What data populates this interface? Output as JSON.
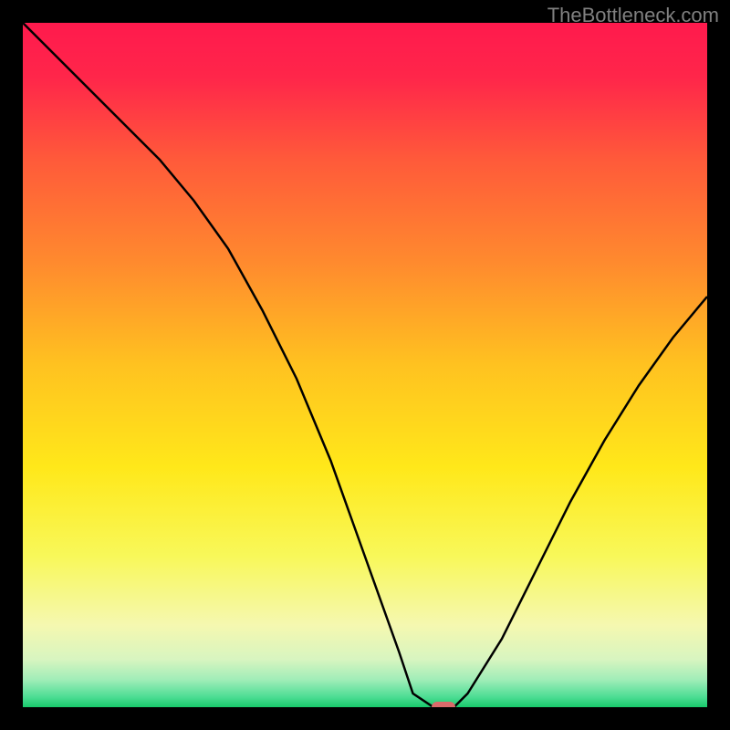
{
  "watermark": "TheBottleneck.com",
  "chart_data": {
    "type": "line",
    "title": "",
    "xlabel": "",
    "ylabel": "",
    "xlim": [
      0,
      100
    ],
    "ylim": [
      0,
      100
    ],
    "series": [
      {
        "name": "bottleneck-curve",
        "x": [
          0,
          5,
          10,
          15,
          20,
          25,
          30,
          35,
          40,
          45,
          50,
          55,
          57,
          60,
          63,
          65,
          70,
          75,
          80,
          85,
          90,
          95,
          100
        ],
        "y": [
          100,
          95,
          90,
          85,
          80,
          74,
          67,
          58,
          48,
          36,
          22,
          8,
          2,
          0,
          0,
          2,
          10,
          20,
          30,
          39,
          47,
          54,
          60
        ]
      }
    ],
    "marker": {
      "x": 61.5,
      "y": 0,
      "color": "#d96a6a"
    },
    "gradient_stops": [
      {
        "pos": 0.0,
        "color": "#ff1a4d"
      },
      {
        "pos": 0.08,
        "color": "#ff264a"
      },
      {
        "pos": 0.2,
        "color": "#ff5a3a"
      },
      {
        "pos": 0.35,
        "color": "#ff8a2e"
      },
      {
        "pos": 0.5,
        "color": "#ffc220"
      },
      {
        "pos": 0.65,
        "color": "#ffe81a"
      },
      {
        "pos": 0.78,
        "color": "#f8f85a"
      },
      {
        "pos": 0.88,
        "color": "#f5f8b0"
      },
      {
        "pos": 0.93,
        "color": "#d8f5c0"
      },
      {
        "pos": 0.96,
        "color": "#a0edb8"
      },
      {
        "pos": 0.985,
        "color": "#4ddd94"
      },
      {
        "pos": 1.0,
        "color": "#18c96b"
      }
    ]
  }
}
